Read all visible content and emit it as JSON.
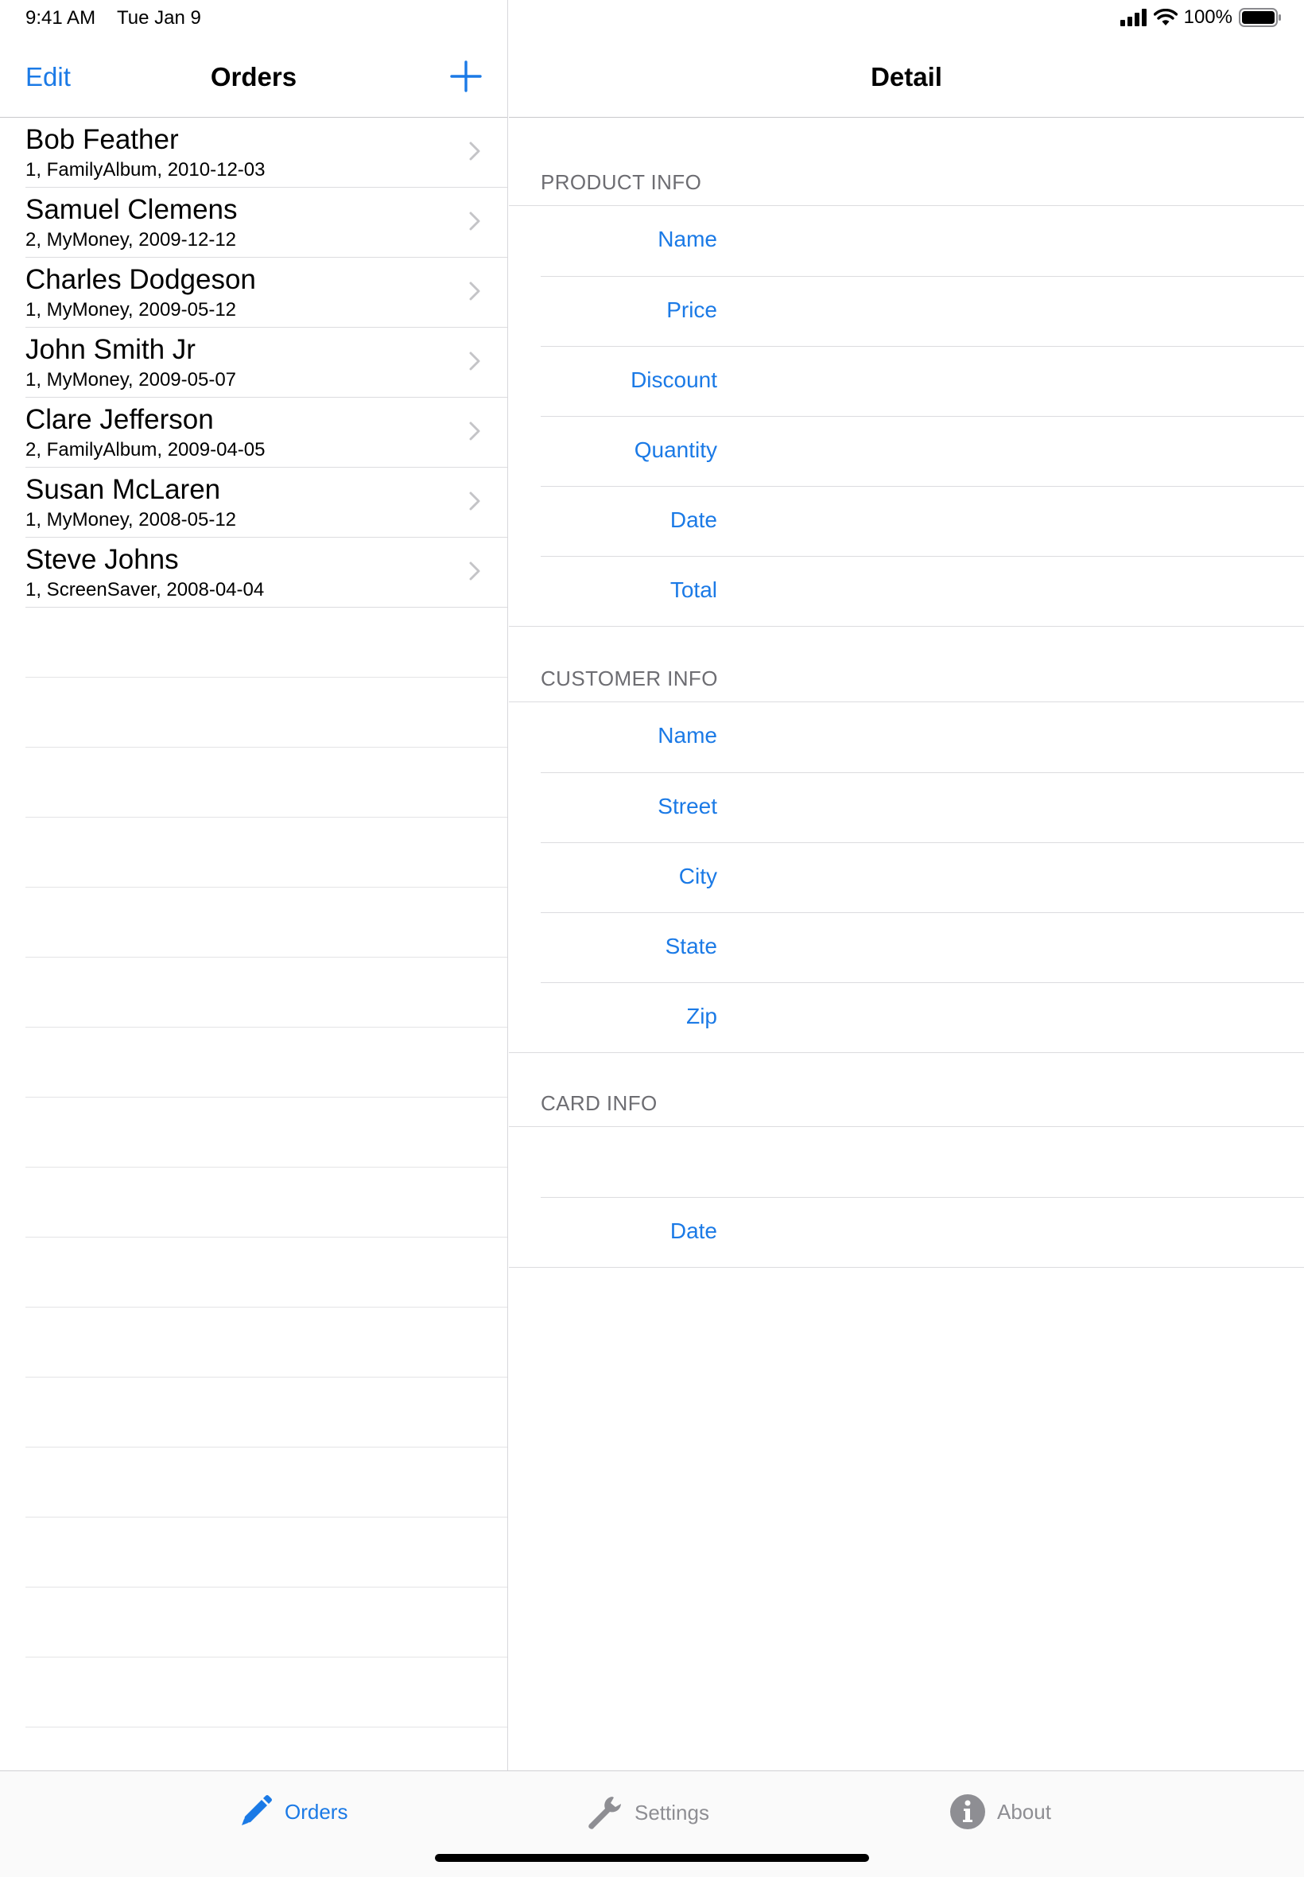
{
  "status_bar": {
    "time": "9:41 AM",
    "date": "Tue Jan 9",
    "battery": "100%"
  },
  "master": {
    "edit_label": "Edit",
    "title": "Orders",
    "add_icon": "plus-icon",
    "orders": [
      {
        "name": "Bob Feather",
        "subtitle": "1, FamilyAlbum, 2010-12-03"
      },
      {
        "name": "Samuel Clemens",
        "subtitle": "2, MyMoney, 2009-12-12"
      },
      {
        "name": "Charles Dodgeson",
        "subtitle": "1, MyMoney, 2009-05-12"
      },
      {
        "name": "John Smith Jr",
        "subtitle": "1, MyMoney, 2009-05-07"
      },
      {
        "name": "Clare Jefferson",
        "subtitle": "2, FamilyAlbum, 2009-04-05"
      },
      {
        "name": "Susan McLaren",
        "subtitle": "1, MyMoney, 2008-05-12"
      },
      {
        "name": "Steve Johns",
        "subtitle": "1, ScreenSaver, 2008-04-04"
      }
    ]
  },
  "detail": {
    "title": "Detail",
    "sections": {
      "product": {
        "header": "PRODUCT INFO",
        "fields": [
          "Name",
          "Price",
          "Discount",
          "Quantity",
          "Date",
          "Total"
        ]
      },
      "customer": {
        "header": "CUSTOMER INFO",
        "fields": [
          "Name",
          "Street",
          "City",
          "State",
          "Zip"
        ]
      },
      "card": {
        "header": "CARD INFO",
        "fields": [
          "",
          "Date"
        ]
      }
    }
  },
  "tab_bar": {
    "orders": {
      "label": "Orders",
      "icon": "pencil-icon",
      "selected": true
    },
    "settings": {
      "label": "Settings",
      "icon": "wrench-icon"
    },
    "about": {
      "label": "About",
      "icon": "info-icon"
    }
  },
  "colors": {
    "accent": "#1b7ae6",
    "section_header": "#6d6d72",
    "separator": "#dcdcdf",
    "tab_inactive": "#8e8e93"
  }
}
